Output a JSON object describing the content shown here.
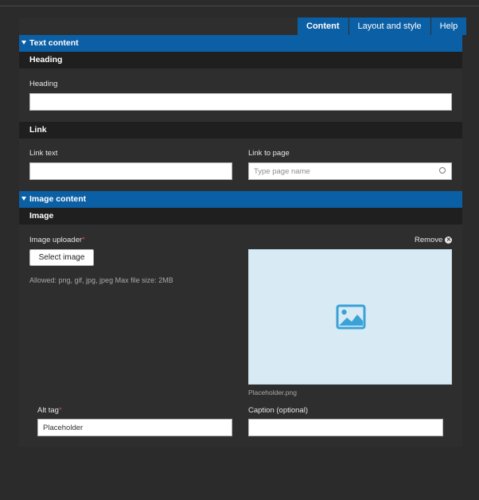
{
  "tabs": [
    {
      "label": "Content",
      "active": true
    },
    {
      "label": "Layout and style",
      "active": false
    },
    {
      "label": "Help",
      "active": false
    }
  ],
  "text_content": {
    "section_label": "Text content",
    "heading_group": {
      "title": "Heading",
      "field_label": "Heading",
      "value": ""
    },
    "link_group": {
      "title": "Link",
      "link_text_label": "Link text",
      "link_text_value": "",
      "link_page_label": "Link to page",
      "link_page_placeholder": "Type page name"
    }
  },
  "image_content": {
    "section_label": "Image content",
    "image_group_title": "Image",
    "uploader_label": "Image uploader",
    "required_mark": "*",
    "select_button": "Select image",
    "allowed_hint": "Allowed: png, gif, jpg, jpeg Max file size: 2MB",
    "remove_label": "Remove",
    "filename": "Placeholder.png",
    "alt_tag_label": "Alt tag",
    "alt_tag_value": "Placeholder",
    "caption_label": "Caption (optional)",
    "caption_value": ""
  },
  "colors": {
    "accent": "#0b5fa5",
    "background": "#2b2b2b",
    "subheader": "#1f1f1f",
    "preview_bg": "#d8ebf4",
    "image_icon": "#3aa2d8",
    "required": "#e5484d"
  }
}
